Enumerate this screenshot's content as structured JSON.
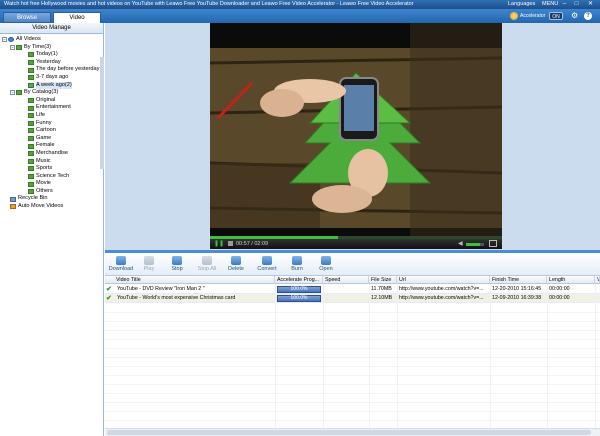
{
  "window": {
    "title": "Watch hot free Hollywood movies and hot videos on YouTube with Leawo Free YouTube Downloader and Leawo Free Video Accelerator - Leawo Free Video Accelerator",
    "languages_label": "Languages",
    "menu_label": "MENU",
    "min_glyph": "–",
    "max_glyph": "□",
    "close_glyph": "✕"
  },
  "header": {
    "accelerator_label": "Accelerator",
    "accelerator_toggle": "ON",
    "gear_glyph": "⚙",
    "help_glyph": "?"
  },
  "tabs": {
    "browse": "Browse",
    "video": "Video"
  },
  "left_panel": {
    "title": "Video Manage",
    "tree": {
      "all_videos": "All Videos",
      "by_time": "By Time(3)",
      "time_items": [
        "Today(1)",
        "Yesterday",
        "The day before yesterday",
        "3-7 days ago",
        "A week ago(2)"
      ],
      "by_catalog": "By Catalog(3)",
      "catalog_items": [
        "Original",
        "Entertainment",
        "Life",
        "Funny",
        "Cartoon",
        "Game",
        "Female",
        "Merchandise",
        "Music",
        "Sports",
        "Science Tech",
        "Movie",
        "Others"
      ],
      "recycle_bin": "Recycle Bin",
      "auto_move": "Auto Move Videos"
    }
  },
  "player": {
    "time": "00:57 / 02:09",
    "progress_fraction": 0.44,
    "pause_glyph": "❚❚",
    "volume_glyph": "◀"
  },
  "toolbar": {
    "download": "Download",
    "play": "Play",
    "stop": "Stop",
    "stop_all": "Stop All",
    "delete": "Delete",
    "convert": "Convert",
    "burn": "Burn",
    "open": "Open"
  },
  "grid": {
    "columns": [
      "Video Title",
      "Accelerate Prog...",
      "Speed",
      "File Size",
      "Url",
      "Finish Time",
      "Length",
      "V"
    ],
    "rows": [
      {
        "title": "YouTube - DVD Review \"Iron Man 2 \"",
        "progress": "100.0%",
        "speed": "",
        "size": "11.70MB",
        "url": "http://www.youtube.com/watch?v=...",
        "finish": "12-20-2010 15:16:45",
        "length": "00:00:00"
      },
      {
        "title": "YouTube - World's most expensive Christmas card",
        "progress": "100.0%",
        "speed": "",
        "size": "12.10MB",
        "url": "http://www.youtube.com/watch?v=...",
        "finish": "12-09-2010 16:39:38",
        "length": "00:00:00"
      }
    ]
  },
  "colors": {
    "titlebar": "#1d4f8c",
    "accent": "#4a8fd6",
    "progress_green": "#3fbf3f",
    "tree_leaf": "#5aa03e"
  }
}
